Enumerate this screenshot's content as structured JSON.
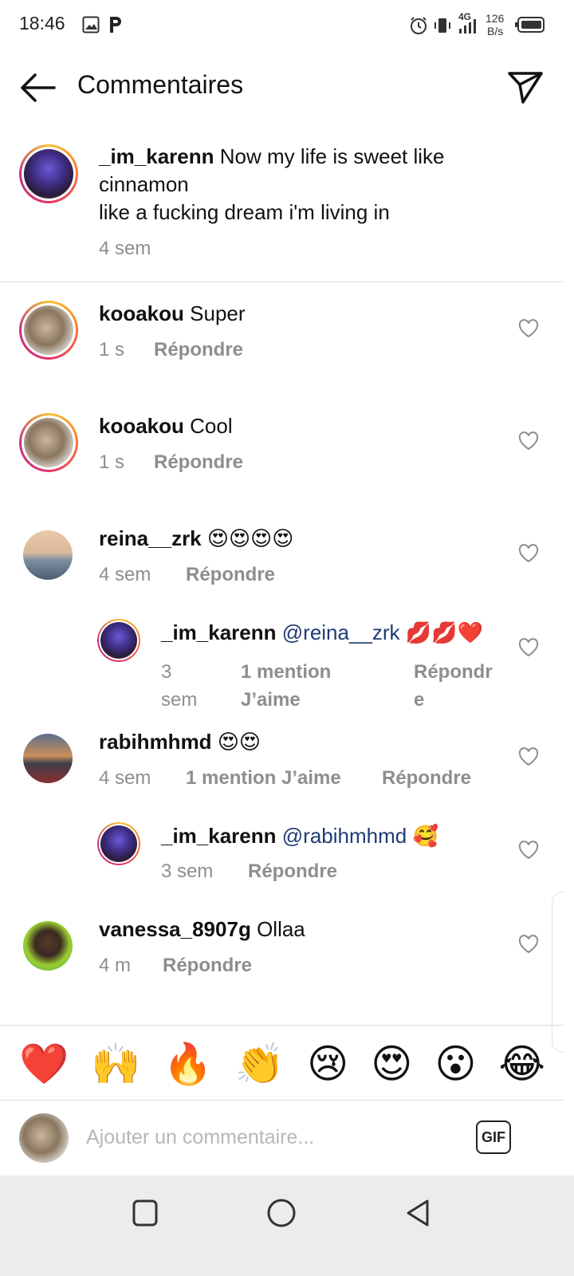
{
  "status_bar": {
    "time": "18:46",
    "network": "4G",
    "speed_value": "126",
    "speed_unit": "B/s",
    "icons": [
      "image-icon",
      "parking-icon",
      "alarm-icon",
      "vibrate-icon",
      "signal-icon",
      "battery-icon"
    ]
  },
  "header": {
    "title": "Commentaires",
    "back_icon": "arrow-left-icon",
    "share_icon": "send-icon"
  },
  "caption": {
    "username": "_im_karenn",
    "text_line1": "Now my life is sweet like",
    "text_line2": "cinnamon",
    "text_line3": "like a fucking dream i'm living in",
    "time": "4 sem"
  },
  "comments": [
    {
      "username": "kooakou",
      "text": "Super",
      "time": "1 s",
      "reply": "Répondre"
    },
    {
      "username": "kooakou",
      "text": "Cool",
      "time": "1 s",
      "reply": "Répondre"
    },
    {
      "username": "reina__zrk",
      "text": "😍😍😍😍",
      "time": "4 sem",
      "reply": "Répondre"
    },
    {
      "username": "_im_karenn",
      "mention": "@reina__zrk",
      "text": "💋💋❤️",
      "time_line1": "3",
      "time_line2": "sem",
      "likes_line1": "1 mention",
      "likes_line2": "J’aime",
      "reply_line1": "Répondr",
      "reply_line2": "e"
    },
    {
      "username": "rabihmhmd",
      "text": "😍😍",
      "time": "4 sem",
      "likes": "1 mention J’aime",
      "reply": "Répondre"
    },
    {
      "username": "_im_karenn",
      "mention": "@rabihmhmd",
      "text": "🥰",
      "time": "3 sem",
      "reply": "Répondre"
    },
    {
      "username": "vanessa_8907g",
      "text": "Ollaa",
      "time": "4 m",
      "reply": "Répondre"
    }
  ],
  "quick_reactions": [
    "❤️",
    "🙌",
    "🔥",
    "👏",
    "😢",
    "😍",
    "😮",
    "😂"
  ],
  "composer": {
    "placeholder": "Ajouter un commentaire...",
    "gif_label": "GIF"
  },
  "nav_bar": {
    "icons": [
      "square-icon",
      "circle-icon",
      "triangle-back-icon"
    ]
  },
  "colors": {
    "mention": "#1f3b73",
    "meta_gray": "#8e8e8e",
    "ring_gradient": [
      "#f9c22e",
      "#e1306c",
      "#c13584"
    ]
  }
}
